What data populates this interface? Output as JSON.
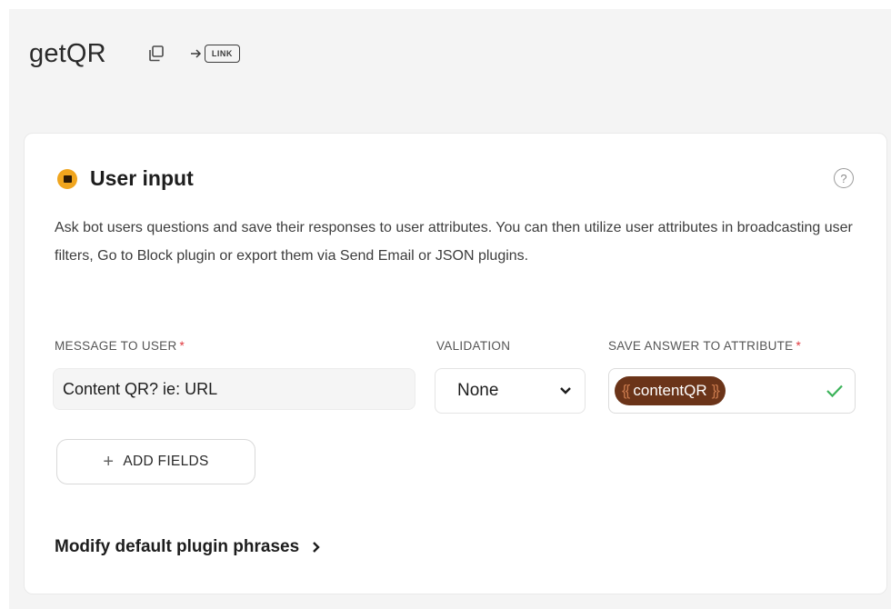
{
  "block": {
    "title": "getQR",
    "link_badge": "LINK"
  },
  "plugin": {
    "title": "User input",
    "help_symbol": "?",
    "description": "Ask bot users questions and save their responses to user attributes. You can then utilize user attributes in broadcasting user filters, Go to Block plugin or export them via Send Email or JSON plugins."
  },
  "fields": {
    "message_label": "MESSAGE TO USER",
    "validation_label": "VALIDATION",
    "save_label": "SAVE ANSWER TO ATTRIBUTE",
    "required_mark": "*",
    "message_value": "Content QR? ie: URL",
    "validation_value": "None",
    "attribute_open": "{{",
    "attribute_name": "contentQR",
    "attribute_close": "}}"
  },
  "actions": {
    "add_fields_plus": "+",
    "add_fields_label": "ADD FIELDS",
    "modify_phrases_label": "Modify default plugin phrases"
  },
  "colors": {
    "page_background": "#f4f4f4",
    "plugin_icon": "#f0a51e",
    "attribute_pill": "#6b3419",
    "required": "#e0383e",
    "check": "#3cb35a"
  },
  "icons": {
    "copy": "copy-icon",
    "link": "link-icon",
    "plugin": "user-input-icon",
    "help": "help-icon",
    "dropdown": "chevron-down-icon",
    "valid": "check-icon",
    "more": "chevron-right-icon"
  }
}
